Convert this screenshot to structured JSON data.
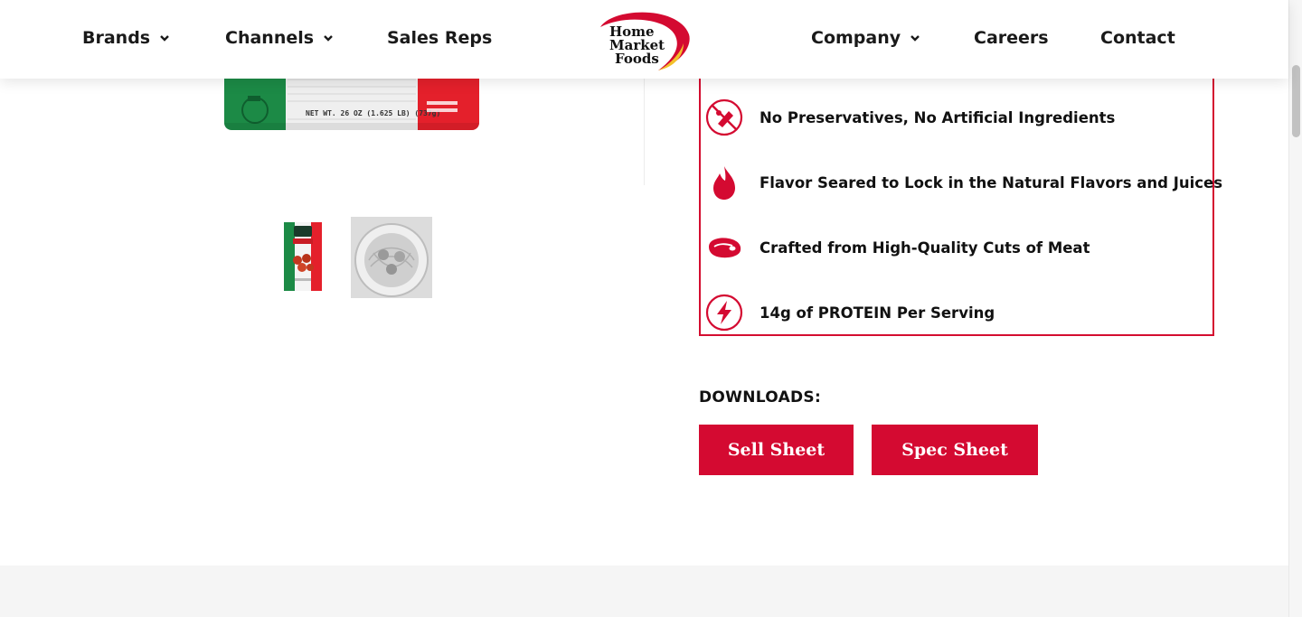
{
  "nav": {
    "brands": "Brands",
    "channels": "Channels",
    "sales_reps": "Sales Reps",
    "company": "Company",
    "careers": "Careers",
    "contact": "Contact"
  },
  "logo": {
    "line1": "Home",
    "line2": "Market",
    "line3": "Foods"
  },
  "product": {
    "net_weight": "NET WT. 26 OZ (1.625 LB) (737g)"
  },
  "features": [
    {
      "icon": "no-preservatives-icon",
      "label": "No Preservatives, No Artificial Ingredients"
    },
    {
      "icon": "flame-icon",
      "label": "Flavor Seared to Lock in the Natural Flavors and Juices"
    },
    {
      "icon": "steak-icon",
      "label": "Crafted from High-Quality Cuts of Meat"
    },
    {
      "icon": "lightning-icon",
      "label": "14g of PROTEIN Per Serving"
    }
  ],
  "downloads": {
    "title": "DOWNLOADS:",
    "sell_sheet": "Sell Sheet",
    "spec_sheet": "Spec Sheet"
  },
  "colors": {
    "accent": "#d40a31",
    "logo_yellow": "#f3c02b"
  }
}
